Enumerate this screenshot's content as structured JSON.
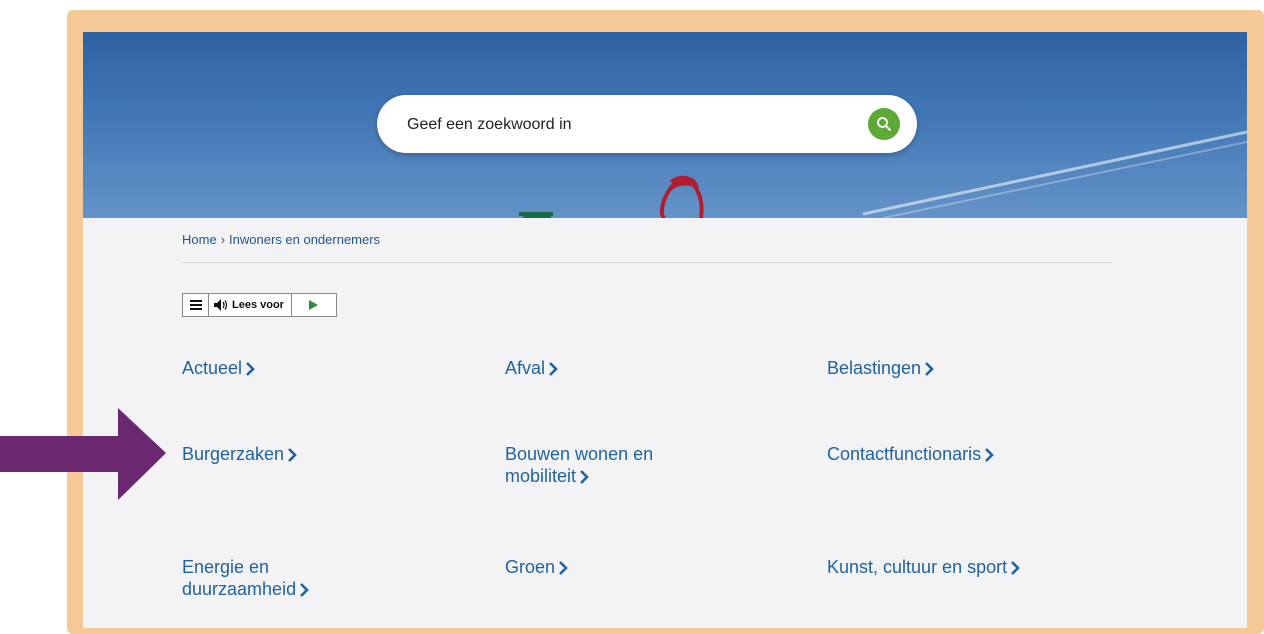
{
  "search": {
    "placeholder": "Geef een zoekwoord in"
  },
  "breadcrumb": {
    "home": "Home",
    "separator": "›",
    "current": "Inwoners en ondernemers"
  },
  "readspeaker": {
    "label": "Lees voor"
  },
  "categories": [
    {
      "label": "Actueel"
    },
    {
      "label": "Afval"
    },
    {
      "label": "Belastingen"
    },
    {
      "label": "Burgerzaken"
    },
    {
      "label": "Bouwen wonen en",
      "label2": "mobiliteit"
    },
    {
      "label": "Contactfunctionaris"
    },
    {
      "label": "Energie en",
      "label2": "duurzaamheid"
    },
    {
      "label": "Groen"
    },
    {
      "label": "Kunst, cultuur en sport"
    }
  ],
  "colors": {
    "frame": "#f5c996",
    "link": "#20639e",
    "search_button": "#5ea836",
    "annotation_arrow": "#6b2770"
  },
  "icons": [
    "search-icon",
    "menu-icon",
    "speaker-icon",
    "play-icon",
    "chevron-right-icon"
  ]
}
